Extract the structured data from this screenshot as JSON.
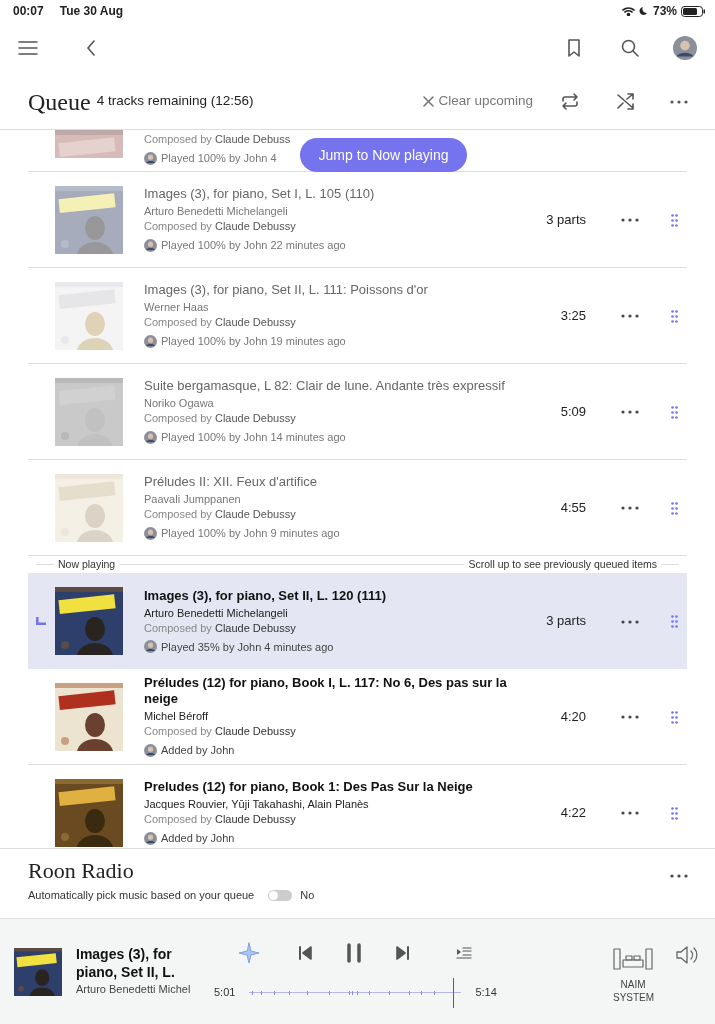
{
  "status_bar": {
    "time": "00:07",
    "date": "Tue 30 Aug",
    "battery": "73%"
  },
  "queue": {
    "title": "Queue",
    "subtitle": "4 tracks remaining (12:56)",
    "clear_button": "Clear upcoming"
  },
  "jump_button": "Jump to Now playing",
  "tracks": [
    {
      "played": true,
      "now_playing": false,
      "composer_prefix": "Composed by",
      "composer": "Claude Debuss",
      "activity": "Played 100% by John 4"
    },
    {
      "played": true,
      "now_playing": false,
      "title": "Images (3), for piano, Set I, L. 105 (110)",
      "artist": "Arturo Benedetti Michelangeli",
      "composer_prefix": "Composed by",
      "composer": "Claude Debussy",
      "duration": "3 parts",
      "activity": "Played 100% by John 22 minutes ago"
    },
    {
      "played": true,
      "now_playing": false,
      "title": "Images (3), for piano, Set II, L. 111: Poissons d'or",
      "artist": "Werner Haas",
      "composer_prefix": "Composed by",
      "composer": "Claude Debussy",
      "duration": "3:25",
      "activity": "Played 100% by John 19 minutes ago"
    },
    {
      "played": true,
      "now_playing": false,
      "title": "Suite bergamasque, L 82: Clair de lune. Andante très expressif",
      "artist": "Noriko Ogawa",
      "composer_prefix": "Composed by",
      "composer": "Claude Debussy",
      "duration": "5:09",
      "activity": "Played 100% by John 14 minutes ago"
    },
    {
      "played": true,
      "now_playing": false,
      "title": "Préludes II: XII. Feux d'artifice",
      "artist": "Paavali Jumppanen",
      "composer_prefix": "Composed by",
      "composer": "Claude Debussy",
      "duration": "4:55",
      "activity": "Played 100% by John 9 minutes ago"
    },
    {
      "played": false,
      "now_playing": true,
      "title": "Images (3), for piano, Set II, L. 120 (111)",
      "artist": "Arturo Benedetti Michelangeli",
      "composer_prefix": "Composed by",
      "composer": "Claude Debussy",
      "duration": "3 parts",
      "activity": "Played 35% by John 4 minutes ago"
    },
    {
      "played": false,
      "now_playing": false,
      "title": "Préludes (12) for piano, Book I, L. 117: No 6, Des pas sur la neige",
      "artist": "Michel Béroff",
      "composer_prefix": "Composed by",
      "composer": "Claude Debussy",
      "duration": "4:20",
      "activity": "Added by John"
    },
    {
      "played": false,
      "now_playing": false,
      "title": "Preludes (12) for piano, Book 1: Des Pas Sur la Neige",
      "artist": "Jacques Rouvier, Yūji Takahashi, Alain Planès",
      "composer_prefix": "Composed by",
      "composer": "Claude Debussy",
      "duration": "4:22",
      "activity": "Added by John"
    }
  ],
  "divider": {
    "label": "Now playing",
    "hint": "Scroll up to see previously queued items"
  },
  "radio": {
    "title": "Roon Radio",
    "description": "Automatically pick music based on your queue",
    "on": false,
    "state_label": "No"
  },
  "player": {
    "title": "Images (3), for piano, Set II, L.",
    "artist": "Arturo Benedetti Michel",
    "elapsed": "5:01",
    "total": "5:14",
    "level": 0.96,
    "playing": true,
    "zone": "NAIM SYSTEM"
  }
}
